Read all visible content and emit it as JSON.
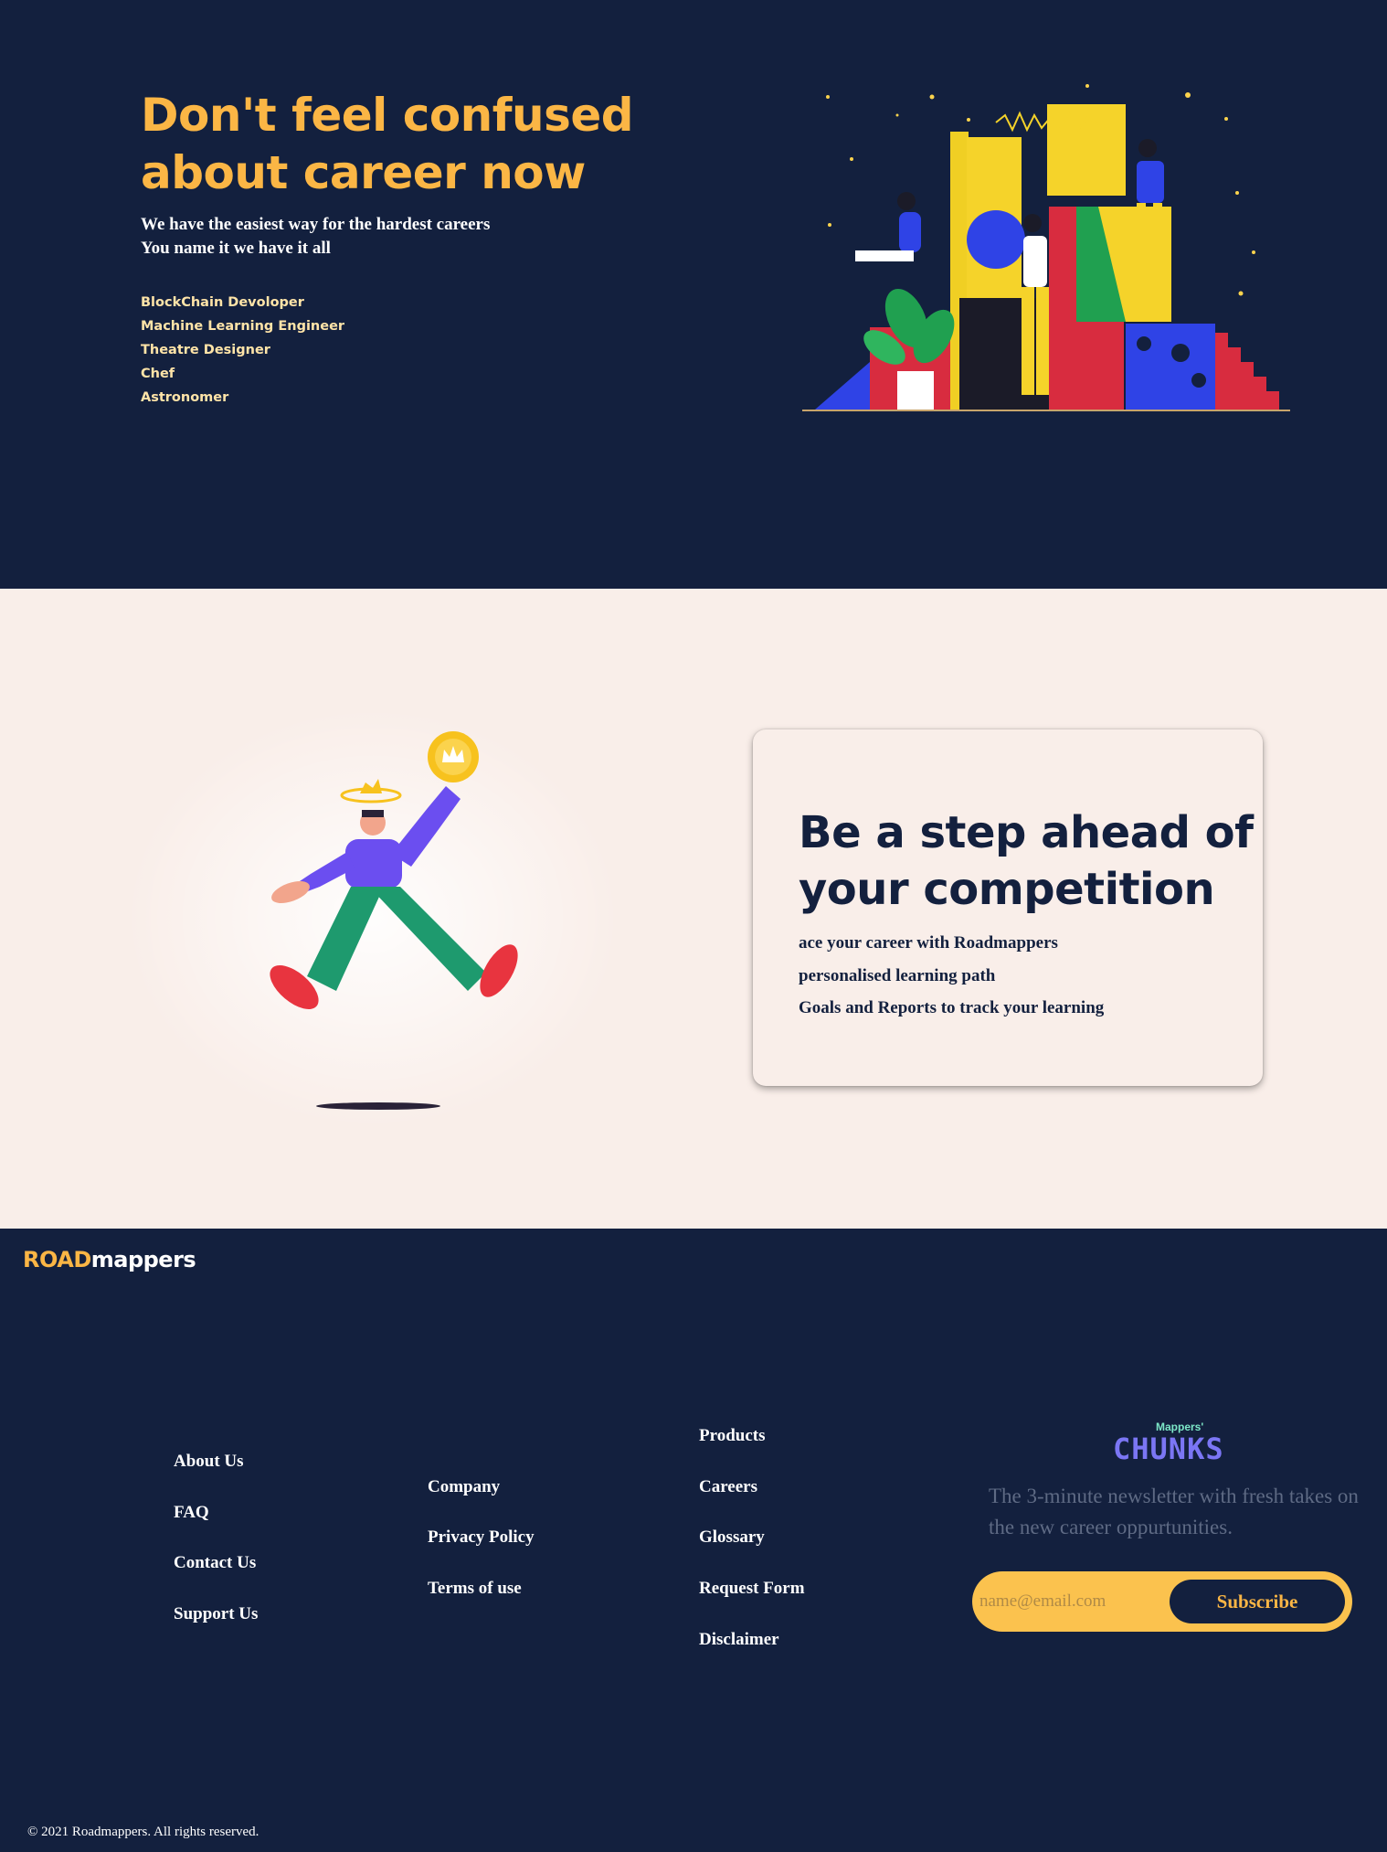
{
  "hero": {
    "title": "Don't feel confused about career now",
    "subtitle_line1": "We have the easiest way for the hardest careers",
    "subtitle_line2": "You name it we have it all",
    "careers": [
      "BlockChain Devoloper",
      "Machine Learning Engineer",
      "Theatre Designer",
      "Chef",
      "Astronomer"
    ]
  },
  "step": {
    "title": "Be a step ahead of your competition",
    "points": [
      "ace your career with Roadmappers",
      "personalised learning path",
      "Goals and Reports to track your learning"
    ]
  },
  "footer": {
    "logo_part1": "ROAD",
    "logo_part2": "mappers",
    "col1": [
      "About Us",
      "FAQ",
      "Contact Us",
      "Support Us"
    ],
    "col2": [
      "Company",
      "Privacy Policy",
      "Terms of use"
    ],
    "col3": [
      "Products",
      "Careers",
      "Glossary",
      "Request Form",
      "Disclaimer"
    ],
    "newsletter": {
      "kicker": "Mappers'",
      "name": "CHUNKS",
      "description": "The 3-minute newsletter with fresh takes on the new career oppurtunities.",
      "email_placeholder": "name@email.com",
      "subscribe_label": "Subscribe"
    },
    "copyright": "© 2021 Roadmappers. All rights reserved."
  },
  "colors": {
    "navy": "#13203e",
    "accent_yellow": "#fbb645",
    "cream": "#f9eee9",
    "chunks_purple": "#7b76f4",
    "chunks_teal": "#7de8c8"
  }
}
